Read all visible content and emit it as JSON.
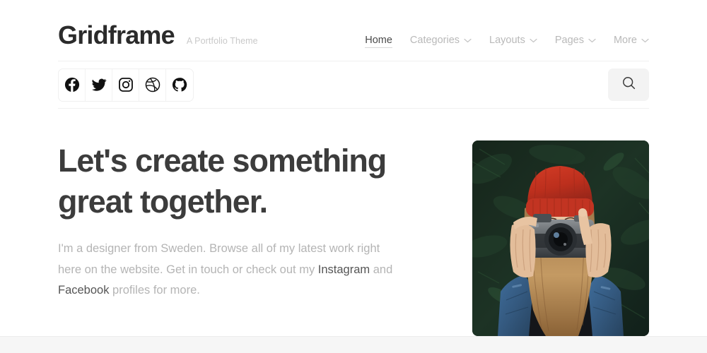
{
  "header": {
    "logo": "Gridframe",
    "tagline": "A Portfolio Theme",
    "nav": [
      {
        "label": "Home",
        "has_chevron": false,
        "active": true
      },
      {
        "label": "Categories",
        "has_chevron": true,
        "active": false
      },
      {
        "label": "Layouts",
        "has_chevron": true,
        "active": false
      },
      {
        "label": "Pages",
        "has_chevron": true,
        "active": false
      },
      {
        "label": "More",
        "has_chevron": true,
        "active": false
      }
    ]
  },
  "social": {
    "items": [
      {
        "name": "facebook-icon",
        "label": "Facebook"
      },
      {
        "name": "twitter-icon",
        "label": "Twitter"
      },
      {
        "name": "instagram-icon",
        "label": "Instagram"
      },
      {
        "name": "dribbble-icon",
        "label": "Dribbble"
      },
      {
        "name": "github-icon",
        "label": "GitHub"
      }
    ]
  },
  "search": {
    "icon": "search-icon",
    "label": "Search"
  },
  "hero": {
    "headline_line1": "Let's create something",
    "headline_line2": "great together.",
    "lede_part1": "I'm a designer from Sweden. Browse all of my latest work right here on the website. Get in touch or check out my ",
    "link1": "Instagram",
    "lede_part2": " and ",
    "link2": "Facebook",
    "lede_part3": " profiles for more.",
    "photo_alt": "Woman in a red beanie and denim jacket holding a vintage camera in front of dark green foliage"
  },
  "colors": {
    "text_dark": "#3c3c3c",
    "text_muted": "#b4b4b4",
    "link": "#555555",
    "divider": "#f0f0f0",
    "search_bg": "#f3f3f3",
    "footer_band": "#f6f6f6"
  }
}
